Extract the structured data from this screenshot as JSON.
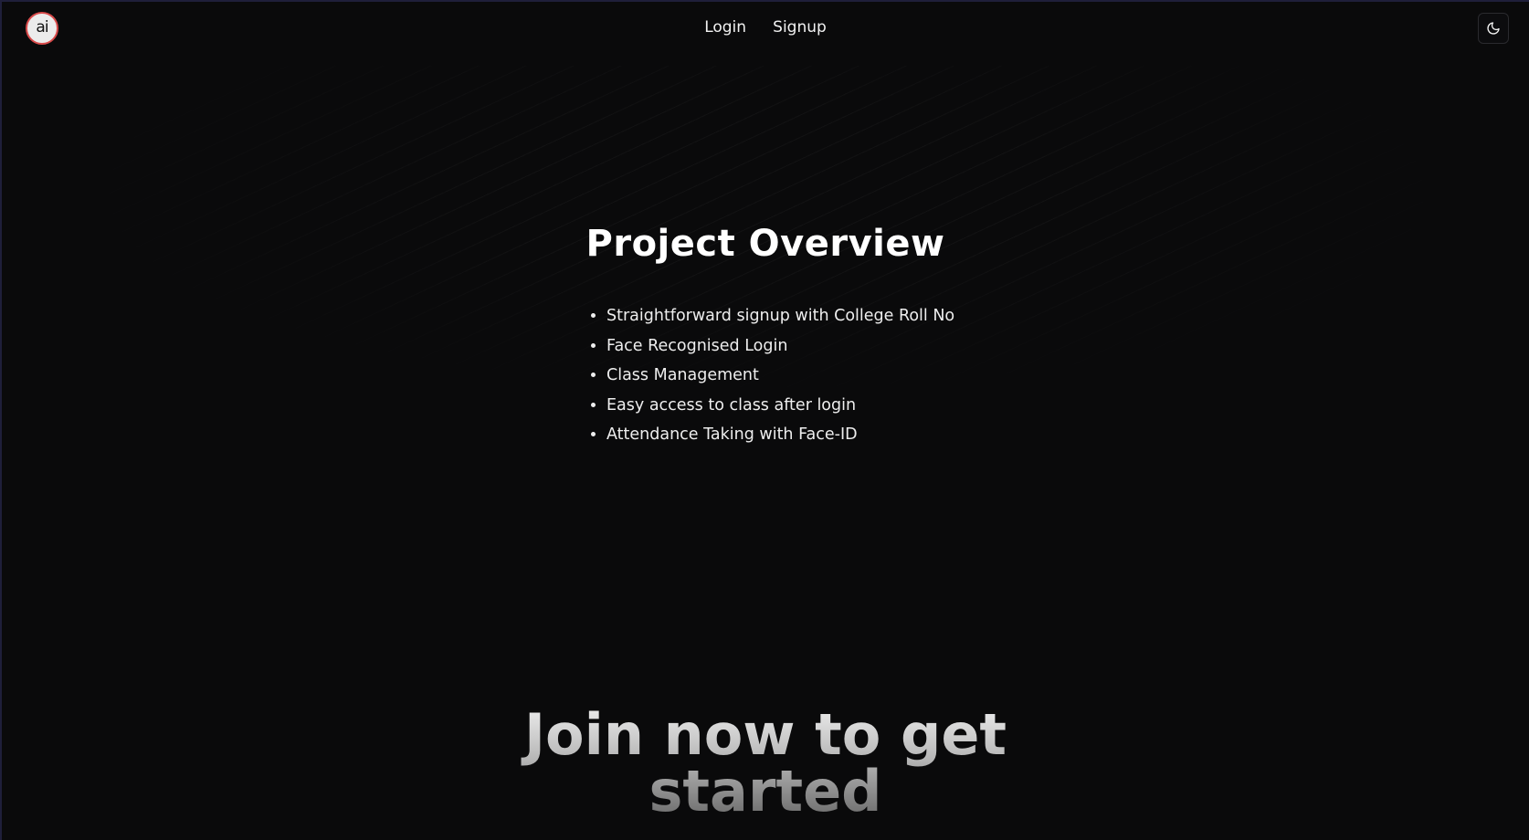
{
  "nav": {
    "logo_text": "ai",
    "links": [
      {
        "label": "Login"
      },
      {
        "label": "Signup"
      }
    ],
    "theme_toggle_icon": "moon-icon"
  },
  "overview": {
    "title": "Project Overview",
    "features": [
      "Straightforward signup with College Roll No",
      "Face Recognised Login",
      "Class Management",
      "Easy access to class after login",
      "Attendance Taking with Face-ID"
    ]
  },
  "cta": {
    "line1": "Join now to get",
    "line2": "started"
  },
  "colors": {
    "background": "#0a0a0b",
    "text": "#f2f2f2",
    "logo_ring": "#d84a4a"
  }
}
